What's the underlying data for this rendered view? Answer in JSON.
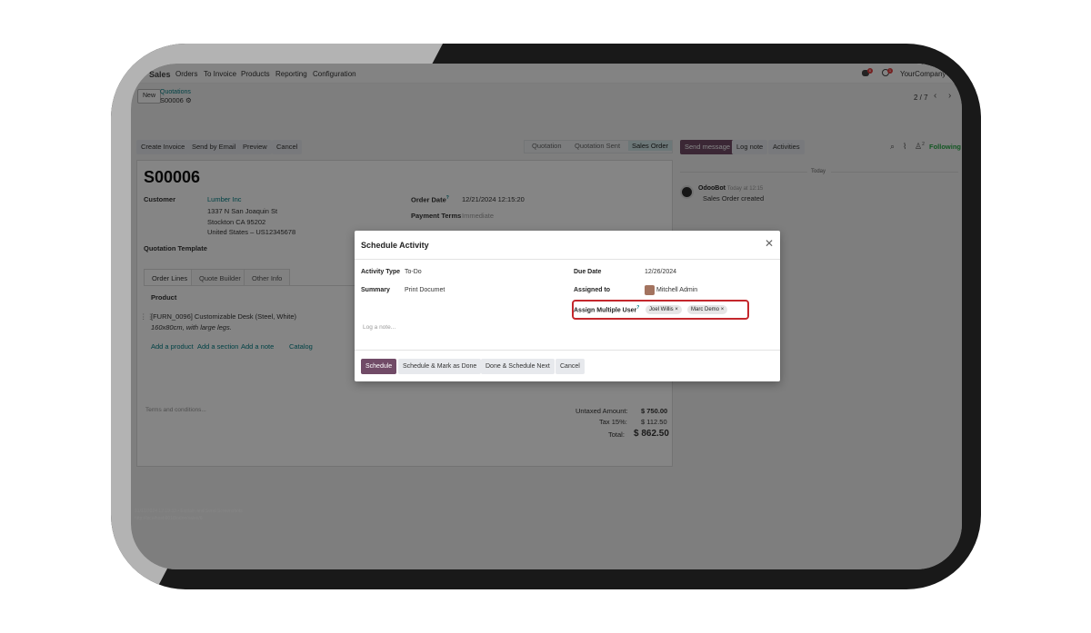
{
  "navbar": {
    "app": "Sales",
    "menu": [
      "Orders",
      "To Invoice",
      "Products",
      "Reporting",
      "Configuration"
    ],
    "messages_badge": "6",
    "activities_badge": "1",
    "company": "YourCompany"
  },
  "breadcrumb": {
    "new_label": "New",
    "parent": "Quotations",
    "record": "S00006",
    "pager": "2 / 7"
  },
  "actions": [
    "Create Invoice",
    "Send by Email",
    "Preview",
    "Cancel"
  ],
  "status_stages": [
    "Quotation",
    "Quotation Sent",
    "Sales Order"
  ],
  "chatter_actions": {
    "send_message": "Send message",
    "log_note": "Log note",
    "activities": "Activities",
    "followers_count": "2",
    "following": "Following"
  },
  "form": {
    "title": "S00006",
    "customer_label": "Customer",
    "customer_name": "Lumber Inc",
    "address": [
      "1337 N San Joaquin St",
      "Stockton CA 95202",
      "United States – US12345678"
    ],
    "order_date_label": "Order Date",
    "order_date": "12/21/2024 12:15:20",
    "payment_terms_label": "Payment Terms",
    "payment_terms": "Immediate",
    "template_label": "Quotation Template",
    "tabs": [
      "Order Lines",
      "Quote Builder",
      "Other Info"
    ],
    "product_header": "Product",
    "line_product": "[FURN_0096] Customizable Desk (Steel, White)",
    "line_description": "160x80cm, with large legs.",
    "line_actions": [
      "Add a product",
      "Add a section",
      "Add a note",
      "Catalog"
    ],
    "terms_placeholder": "Terms and conditions...",
    "totals": {
      "untaxed_label": "Untaxed Amount:",
      "untaxed": "$ 750.00",
      "tax_label": "Tax 15%:",
      "tax": "$ 112.50",
      "total_label": "Total:",
      "total": "$ 862.50"
    }
  },
  "chatter": {
    "date_separator": "Today",
    "author": "OdooBot",
    "when": "Today at 12:15",
    "message": "Sales Order created"
  },
  "footer": {
    "line1": "21/12/2024 12:19:33 • Explain and Send Screenshots",
    "line2": "http://localhost:8018/odoo/sales/6"
  },
  "dialog": {
    "title": "Schedule Activity",
    "activity_type_label": "Activity Type",
    "activity_type": "To-Do",
    "summary_label": "Summary",
    "summary": "Print Documet",
    "due_date_label": "Due Date",
    "due_date": "12/26/2024",
    "assigned_to_label": "Assigned to",
    "assigned_to": "Mitchell Admin",
    "assign_multiple_label": "Assign Multiple User",
    "tags": [
      "Joel Willis",
      "Marc Demo"
    ],
    "note_placeholder": "Log a note...",
    "buttons": {
      "schedule": "Schedule",
      "schedule_done": "Schedule & Mark as Done",
      "done_next": "Done & Schedule Next",
      "cancel": "Cancel"
    }
  },
  "colors": {
    "primary": "#714b67",
    "link": "#017e84",
    "highlight": "#c4272c",
    "following": "#28a745"
  }
}
